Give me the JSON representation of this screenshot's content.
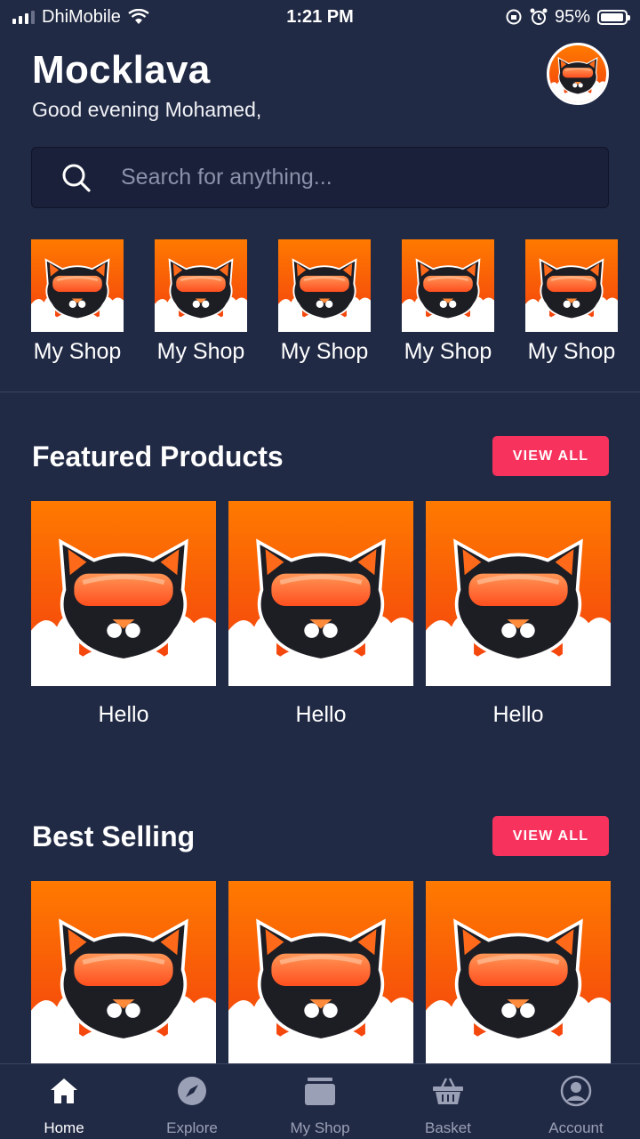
{
  "status_bar": {
    "carrier": "DhiMobile",
    "time": "1:21 PM",
    "battery": "95%",
    "battery_level": 0.95
  },
  "header": {
    "title": "Mocklava",
    "greeting": "Good evening Mohamed,"
  },
  "search": {
    "placeholder": "Search for anything..."
  },
  "shops": [
    {
      "label": "My Shop"
    },
    {
      "label": "My Shop"
    },
    {
      "label": "My Shop"
    },
    {
      "label": "My Shop"
    },
    {
      "label": "My Shop"
    }
  ],
  "featured": {
    "title": "Featured Products",
    "view_all": "VIEW ALL",
    "items": [
      {
        "label": "Hello"
      },
      {
        "label": "Hello"
      },
      {
        "label": "Hello"
      }
    ]
  },
  "best_selling": {
    "title": "Best Selling",
    "view_all": "VIEW ALL",
    "items": [
      {
        "label": ""
      },
      {
        "label": ""
      },
      {
        "label": ""
      }
    ]
  },
  "nav": [
    {
      "label": "Home",
      "icon": "home-icon",
      "active": true
    },
    {
      "label": "Explore",
      "icon": "compass-icon"
    },
    {
      "label": "My Shop",
      "icon": "shop-icon"
    },
    {
      "label": "Basket",
      "icon": "basket-icon"
    },
    {
      "label": "Account",
      "icon": "account-icon"
    }
  ],
  "colors": {
    "background": "#212a45",
    "accent": "#f7325d",
    "brand_orange": "#ff6a00"
  }
}
